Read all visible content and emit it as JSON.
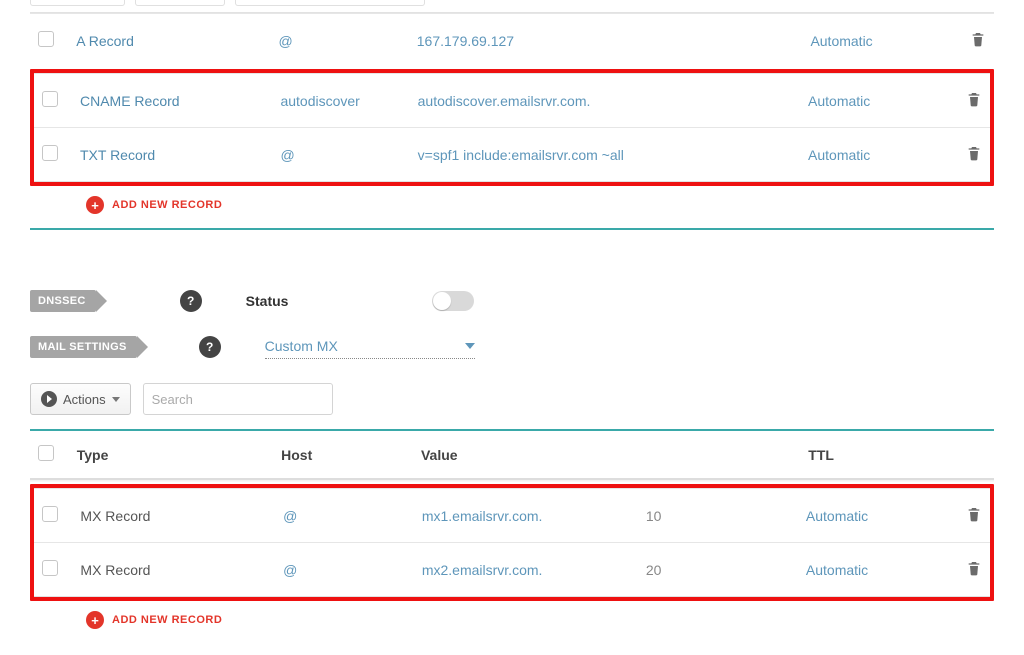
{
  "records1": {
    "rows": [
      {
        "type": "A Record",
        "host": "@",
        "value": "167.179.69.127",
        "ttl": "Automatic",
        "highlighted": false
      },
      {
        "type": "CNAME Record",
        "host": "autodiscover",
        "value": "autodiscover.emailsrvr.com.",
        "ttl": "Automatic",
        "highlighted": true
      },
      {
        "type": "TXT Record",
        "host": "@",
        "value": "v=spf1 include:emailsrvr.com ~all",
        "ttl": "Automatic",
        "highlighted": true
      }
    ]
  },
  "add_record_label": "ADD NEW RECORD",
  "dnssec": {
    "tag": "DNSSEC",
    "status_label": "Status",
    "enabled": false
  },
  "mail": {
    "tag": "MAIL SETTINGS",
    "selected": "Custom MX"
  },
  "toolbar": {
    "actions_label": "Actions",
    "search_placeholder": "Search"
  },
  "records2": {
    "headers": {
      "type": "Type",
      "host": "Host",
      "value": "Value",
      "ttl": "TTL"
    },
    "rows": [
      {
        "type": "MX Record",
        "host": "@",
        "value": "mx1.emailsrvr.com.",
        "priority": "10",
        "ttl": "Automatic"
      },
      {
        "type": "MX Record",
        "host": "@",
        "value": "mx2.emailsrvr.com.",
        "priority": "20",
        "ttl": "Automatic"
      }
    ]
  }
}
